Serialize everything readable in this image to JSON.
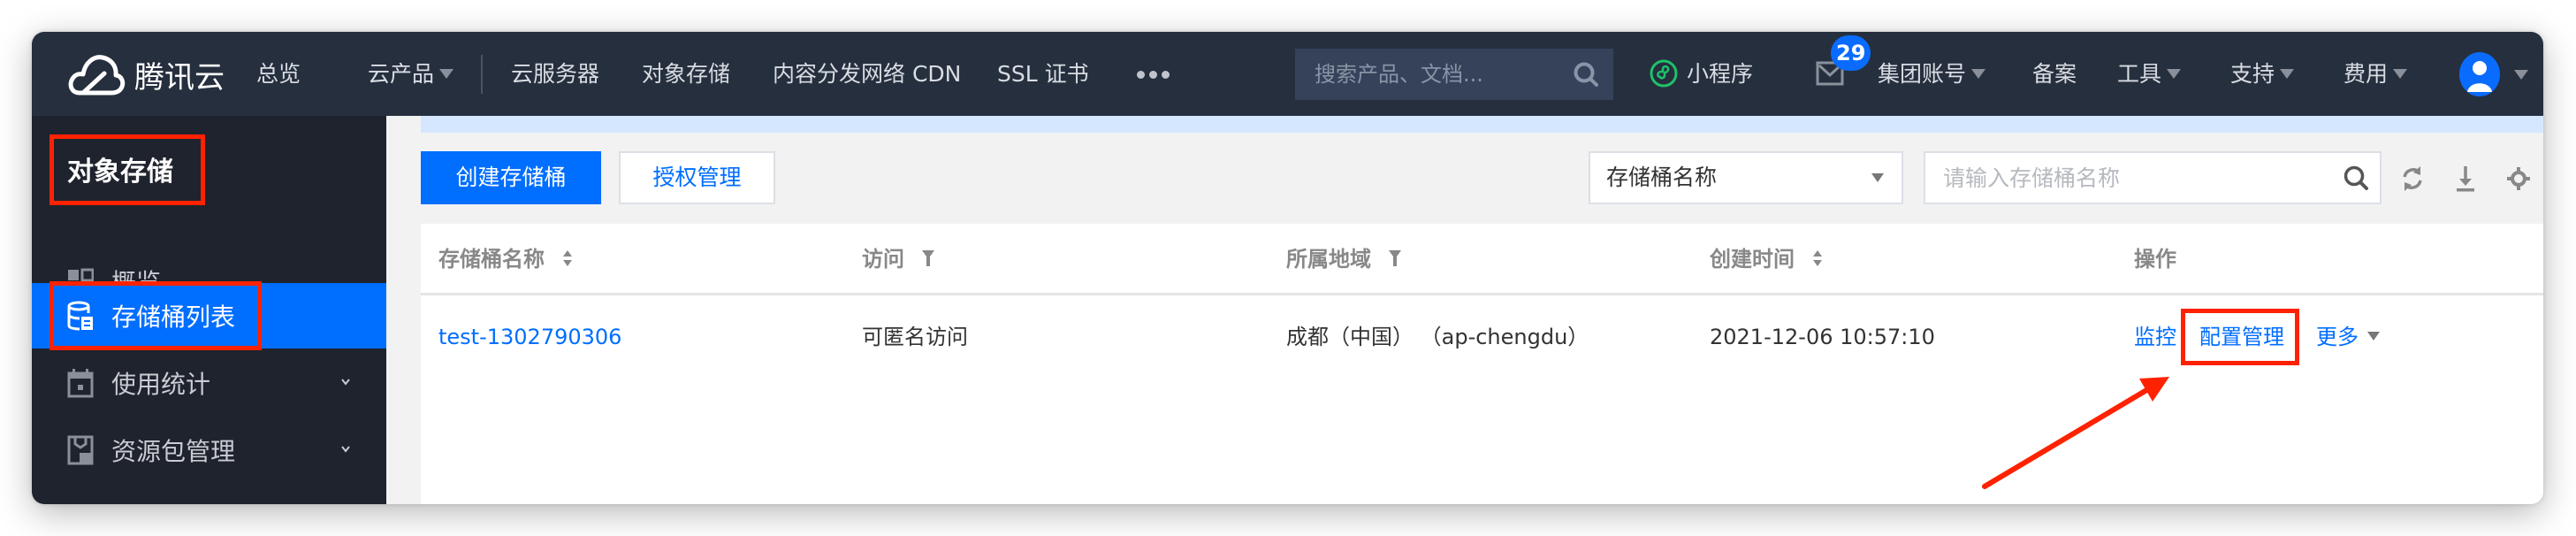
{
  "topbar": {
    "brand": "腾讯云",
    "nav": [
      {
        "label": "总览",
        "dropdown": false
      },
      {
        "label": "云产品",
        "dropdown": true
      },
      {
        "label": "云服务器",
        "dropdown": false
      },
      {
        "label": "对象存储",
        "dropdown": false
      },
      {
        "label": "内容分发网络 CDN",
        "dropdown": false
      },
      {
        "label": "SSL 证书",
        "dropdown": false
      }
    ],
    "more_icon": "ellipsis-icon",
    "search_placeholder": "搜索产品、文档...",
    "mini_program": "小程序",
    "mail_badge": "29",
    "right_menu": [
      {
        "label": "集团账号",
        "dropdown": true
      },
      {
        "label": "备案",
        "dropdown": false
      },
      {
        "label": "工具",
        "dropdown": true
      },
      {
        "label": "支持",
        "dropdown": true
      },
      {
        "label": "费用",
        "dropdown": true
      }
    ]
  },
  "sidebar": {
    "title": "对象存储",
    "items": [
      {
        "label": "概览",
        "icon": "grid-icon",
        "active": false,
        "expandable": false
      },
      {
        "label": "存储桶列表",
        "icon": "bucket-list-icon",
        "active": true,
        "expandable": false
      },
      {
        "label": "使用统计",
        "icon": "calendar-icon",
        "active": false,
        "expandable": true
      },
      {
        "label": "资源包管理",
        "icon": "package-icon",
        "active": false,
        "expandable": true
      }
    ]
  },
  "toolbar": {
    "create_label": "创建存储桶",
    "auth_label": "授权管理",
    "filter_select_value": "存储桶名称",
    "filter_placeholder": "请输入存储桶名称",
    "icons": [
      "search-icon",
      "refresh-icon",
      "download-icon",
      "settings-icon"
    ]
  },
  "table": {
    "columns": [
      {
        "label": "存储桶名称",
        "control": "sort"
      },
      {
        "label": "访问",
        "control": "filter"
      },
      {
        "label": "所属地域",
        "control": "filter"
      },
      {
        "label": "创建时间",
        "control": "sort"
      },
      {
        "label": "操作",
        "control": "none"
      }
    ],
    "rows": [
      {
        "name": "test-1302790306",
        "access": "可匿名访问",
        "region": "成都（中国） （ap-chengdu）",
        "created": "2021-12-06 10:57:10",
        "actions": [
          "监控",
          "配置管理",
          "更多"
        ]
      }
    ]
  },
  "colors": {
    "topbar_bg": "#262f3e",
    "sidebar_bg": "#1f232d",
    "accent": "#006eff",
    "annotation": "#ff2200"
  }
}
